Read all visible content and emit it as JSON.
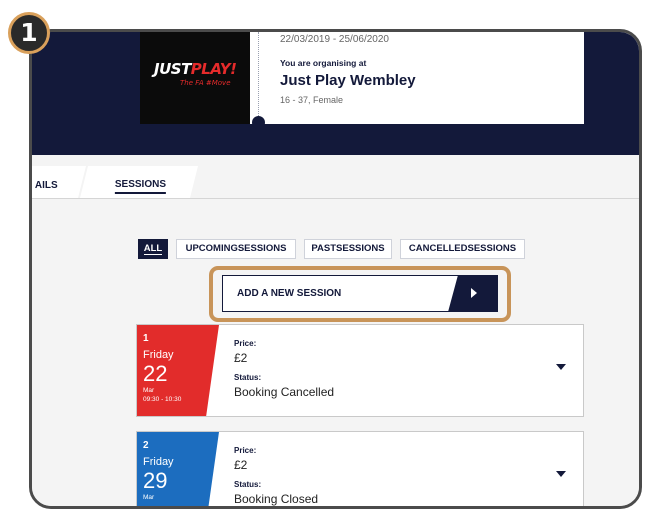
{
  "step_badge": "1",
  "event": {
    "logo_main": "JUST",
    "logo_accent": "PLAY!",
    "logo_sub": "The FA #Move",
    "dates": "22/03/2019 - 25/06/2020",
    "organising_label": "You are organising at",
    "venue": "Just Play Wembley",
    "meta": "16 - 37, Female"
  },
  "tabs": [
    {
      "label": "AILS"
    },
    {
      "label": "SESSIONS"
    }
  ],
  "filters": [
    {
      "label": "ALL",
      "active": true
    },
    {
      "label": "UPCOMINGSESSIONS"
    },
    {
      "label": "PASTSESSIONS"
    },
    {
      "label": "CANCELLEDSESSIONS"
    }
  ],
  "add_session": {
    "label": "ADD A NEW SESSION"
  },
  "sessions": [
    {
      "number": "1",
      "day": "Friday",
      "date": "22",
      "month": "Mar",
      "time": "09:30 - 10:30",
      "price_label": "Price:",
      "price": "£2",
      "status_label": "Status:",
      "status": "Booking Cancelled",
      "color": "#e22c2b"
    },
    {
      "number": "2",
      "day": "Friday",
      "date": "29",
      "month": "Mar",
      "price_label": "Price:",
      "price": "£2",
      "status_label": "Status:",
      "status": "Booking Closed",
      "color": "#1c6dbf"
    }
  ],
  "colors": {
    "navy": "#13193a",
    "highlight": "#c89459",
    "cancelled": "#e22c2b",
    "closed": "#1c6dbf"
  },
  "icons": {
    "add_arrow": "chevron-right-icon",
    "expand": "chevron-down-icon"
  }
}
